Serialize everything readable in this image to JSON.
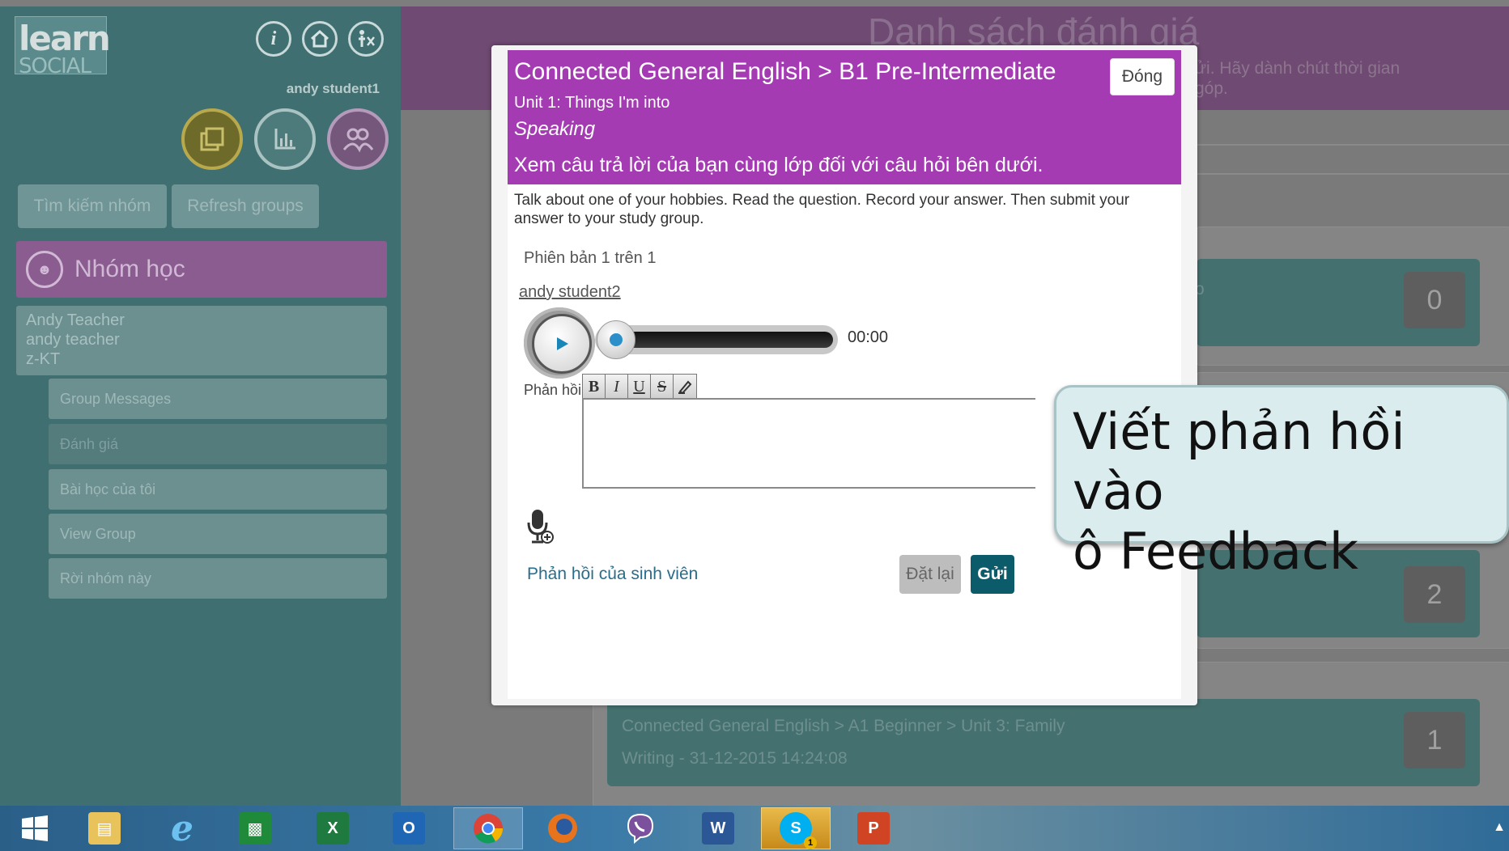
{
  "sidebar": {
    "logo_line1": "learn",
    "logo_line2": "SOCIAL",
    "top_icons": [
      "info-icon",
      "home-icon",
      "accessibility-icon"
    ],
    "username": "andy student1",
    "circle_buttons": [
      "stack-icon",
      "chart-icon",
      "group-icon"
    ],
    "search_groups_label": "Tìm kiếm nhóm",
    "refresh_groups_label": "Refresh groups",
    "group_header_label": "Nhóm học",
    "group_card": {
      "line1": "Andy Teacher",
      "line2": "andy teacher",
      "line3": "z-KT"
    },
    "sub_items": [
      {
        "label": "Group Messages"
      },
      {
        "label": "Đánh giá"
      },
      {
        "label": "Bài học của tôi"
      },
      {
        "label": "View Group"
      },
      {
        "label": "Rời nhóm này"
      }
    ]
  },
  "main": {
    "title": "Danh sách đánh giá",
    "subtitle_line1": "ửi. Hãy dành chút thời gian",
    "subtitle_line2": "góp.",
    "cards": [
      {
        "count": "0",
        "partial_text": "o"
      },
      {
        "count": "2"
      },
      {
        "count": "1",
        "line1": "Connected General English > A1 Beginner > Unit 3: Family",
        "line2": "Writing - 31-12-2015 14:24:08"
      }
    ]
  },
  "modal": {
    "title": "Connected General English > B1 Pre-Intermediate",
    "close_label": "Đóng",
    "unit": "Unit 1: Things I'm into",
    "skill": "Speaking",
    "instruction": "Xem câu trả lời của bạn cùng lớp đối với câu hỏi bên dưới.",
    "question": "Talk about one of your hobbies. Read the question. Record your answer. Then submit your answer to your study group.",
    "version": "Phiên bản 1 trên 1",
    "author": "andy student2",
    "time": "00:00",
    "feedback_label": "Phản hồi",
    "toolbar": [
      "B",
      "I",
      "U",
      "S",
      "✎"
    ],
    "feedback_value": "",
    "student_feedback_link": "Phản hồi của sinh viên",
    "reset_label": "Đặt lại",
    "send_label": "Gửi"
  },
  "callout": {
    "line1": "Viết phản hồi vào",
    "line2": "ô Feedback"
  },
  "taskbar": {
    "apps": [
      "windows-start",
      "file-explorer",
      "internet-explorer",
      "store",
      "excel",
      "outlook",
      "chrome",
      "firefox",
      "viber",
      "word",
      "skype",
      "powerpoint"
    ],
    "skype_badge": "1"
  },
  "colors": {
    "modal_header": "#a43bb3",
    "send_button": "#0b5b6b",
    "callout_bg": "#dbecee",
    "sidebar_bg": "#3f6f70"
  }
}
